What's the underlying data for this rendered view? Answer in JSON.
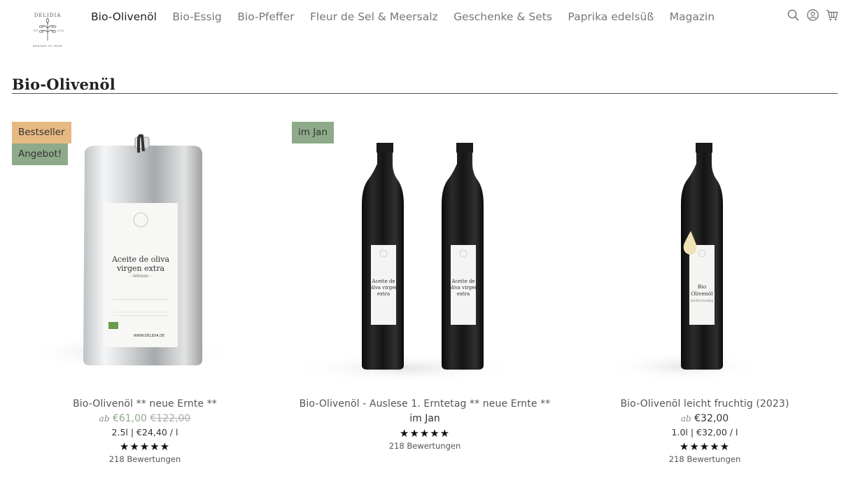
{
  "brand": {
    "name": "DELIDIA",
    "established_left": "EST",
    "established_year": "2018",
    "tagline": "WENIGER IST MEHR"
  },
  "nav": {
    "items": [
      {
        "label": "Bio-Olivenöl",
        "active": true
      },
      {
        "label": "Bio-Essig"
      },
      {
        "label": "Bio-Pfeffer"
      },
      {
        "label": "Fleur de Sel & Meersalz"
      },
      {
        "label": "Geschenke & Sets"
      },
      {
        "label": "Paprika edelsüß"
      },
      {
        "label": "Magazin"
      }
    ]
  },
  "header_icons": [
    "search-icon",
    "account-icon",
    "cart-icon"
  ],
  "page": {
    "title": "Bio-Olivenöl"
  },
  "colors": {
    "sale": "#8eaa8a",
    "badge_orange": "#e6b882",
    "badge_green": "#8eaa8a"
  },
  "products": [
    {
      "badges": [
        "Bestseller",
        "Angebot!"
      ],
      "name": "Bio-Olivenöl ** neue Ernte **",
      "price_prefix": "ab",
      "price": "€61,00",
      "compare_price": "€122,00",
      "unit_price": "2.5l | €24,40 / l",
      "rating_stars": 5,
      "reviews": "218 Bewertungen",
      "label_text": [
        "Aceite de oliva",
        "virgen extra",
        "- intenso -",
        "WWW.DELIDIA.DE"
      ]
    },
    {
      "badges": [
        "im Jan"
      ],
      "name": "Bio-Olivenöl - Auslese 1. Erntetag ** neue Ernte **",
      "availability": "im Jan",
      "rating_stars": 5,
      "reviews": "218 Bewertungen",
      "label_text": [
        "Aceite de",
        "oliva virgen",
        "extra"
      ]
    },
    {
      "badges": [],
      "name": "Bio-Olivenöl leicht fruchtig (2023)",
      "price_prefix": "ab",
      "price": "€32,00",
      "unit_price": "1.0l | €32,00 / l",
      "rating_stars": 5,
      "reviews": "218 Bewertungen",
      "label_text": [
        "Bio",
        "Olivenöl",
        "leicht fruchtig"
      ]
    }
  ],
  "stars_glyph": "★★★★★"
}
